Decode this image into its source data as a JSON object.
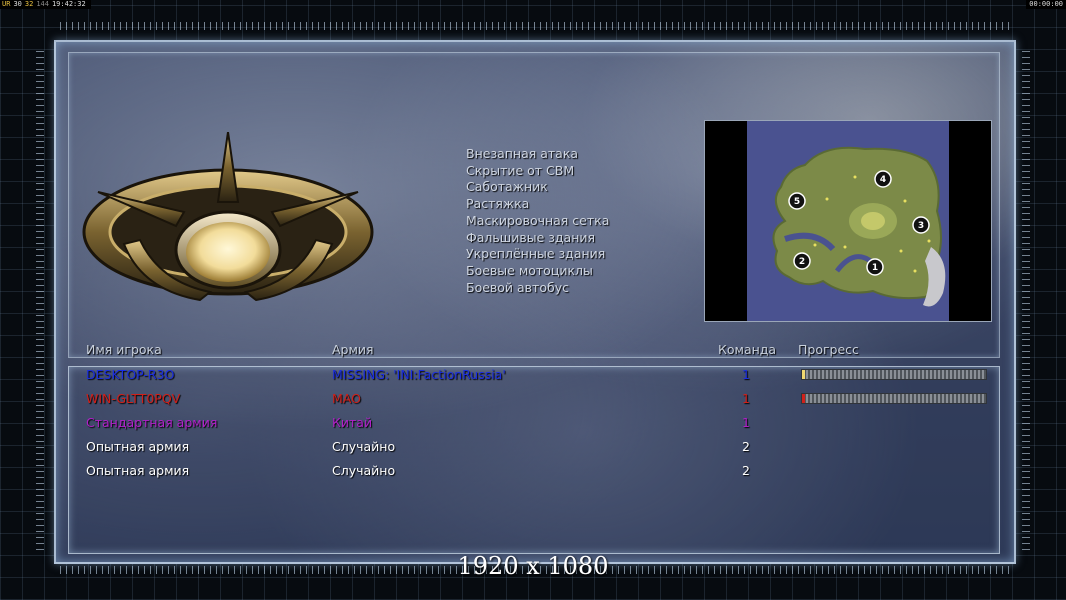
{
  "hud": {
    "left": [
      "UR",
      "30",
      "32",
      "144",
      "19:42:32"
    ],
    "right": "00:00:00"
  },
  "options": [
    "Внезапная атака",
    "Скрытие от СВМ",
    "Саботажник",
    "Растяжка",
    "Маскировочная сетка",
    "Фальшивые здания",
    "Укреплённые здания",
    "Боевые мотоциклы",
    "Боевой автобус"
  ],
  "minimap": {
    "start_positions": [
      "1",
      "2",
      "3",
      "4",
      "5"
    ]
  },
  "table": {
    "headers": {
      "player": "Имя игрока",
      "army": "Армия",
      "team": "Команда",
      "progress": "Прогресс"
    },
    "rows": [
      {
        "player": "DESKTOP-R3O",
        "army": "MISSING: 'INI:FactionRussia'",
        "team": "1",
        "color": "#1a2ee0",
        "progress": 0.01,
        "progress_color": "#f0d870"
      },
      {
        "player": "WIN-GLTT0PQV",
        "army": "MAO",
        "team": "1",
        "color": "#d0201a",
        "progress": 0.01,
        "progress_color": "#d0201a"
      },
      {
        "player": "Стандартная армия",
        "army": "Китай",
        "team": "1",
        "color": "#b020c8",
        "progress": null,
        "progress_color": ""
      },
      {
        "player": "Опытная армия",
        "army": "Случайно",
        "team": "2",
        "color": "#ffffff",
        "progress": null,
        "progress_color": ""
      },
      {
        "player": "Опытная армия",
        "army": "Случайно",
        "team": "2",
        "color": "#ffffff",
        "progress": null,
        "progress_color": ""
      }
    ]
  },
  "resolution_caption": "1920 x 1080"
}
